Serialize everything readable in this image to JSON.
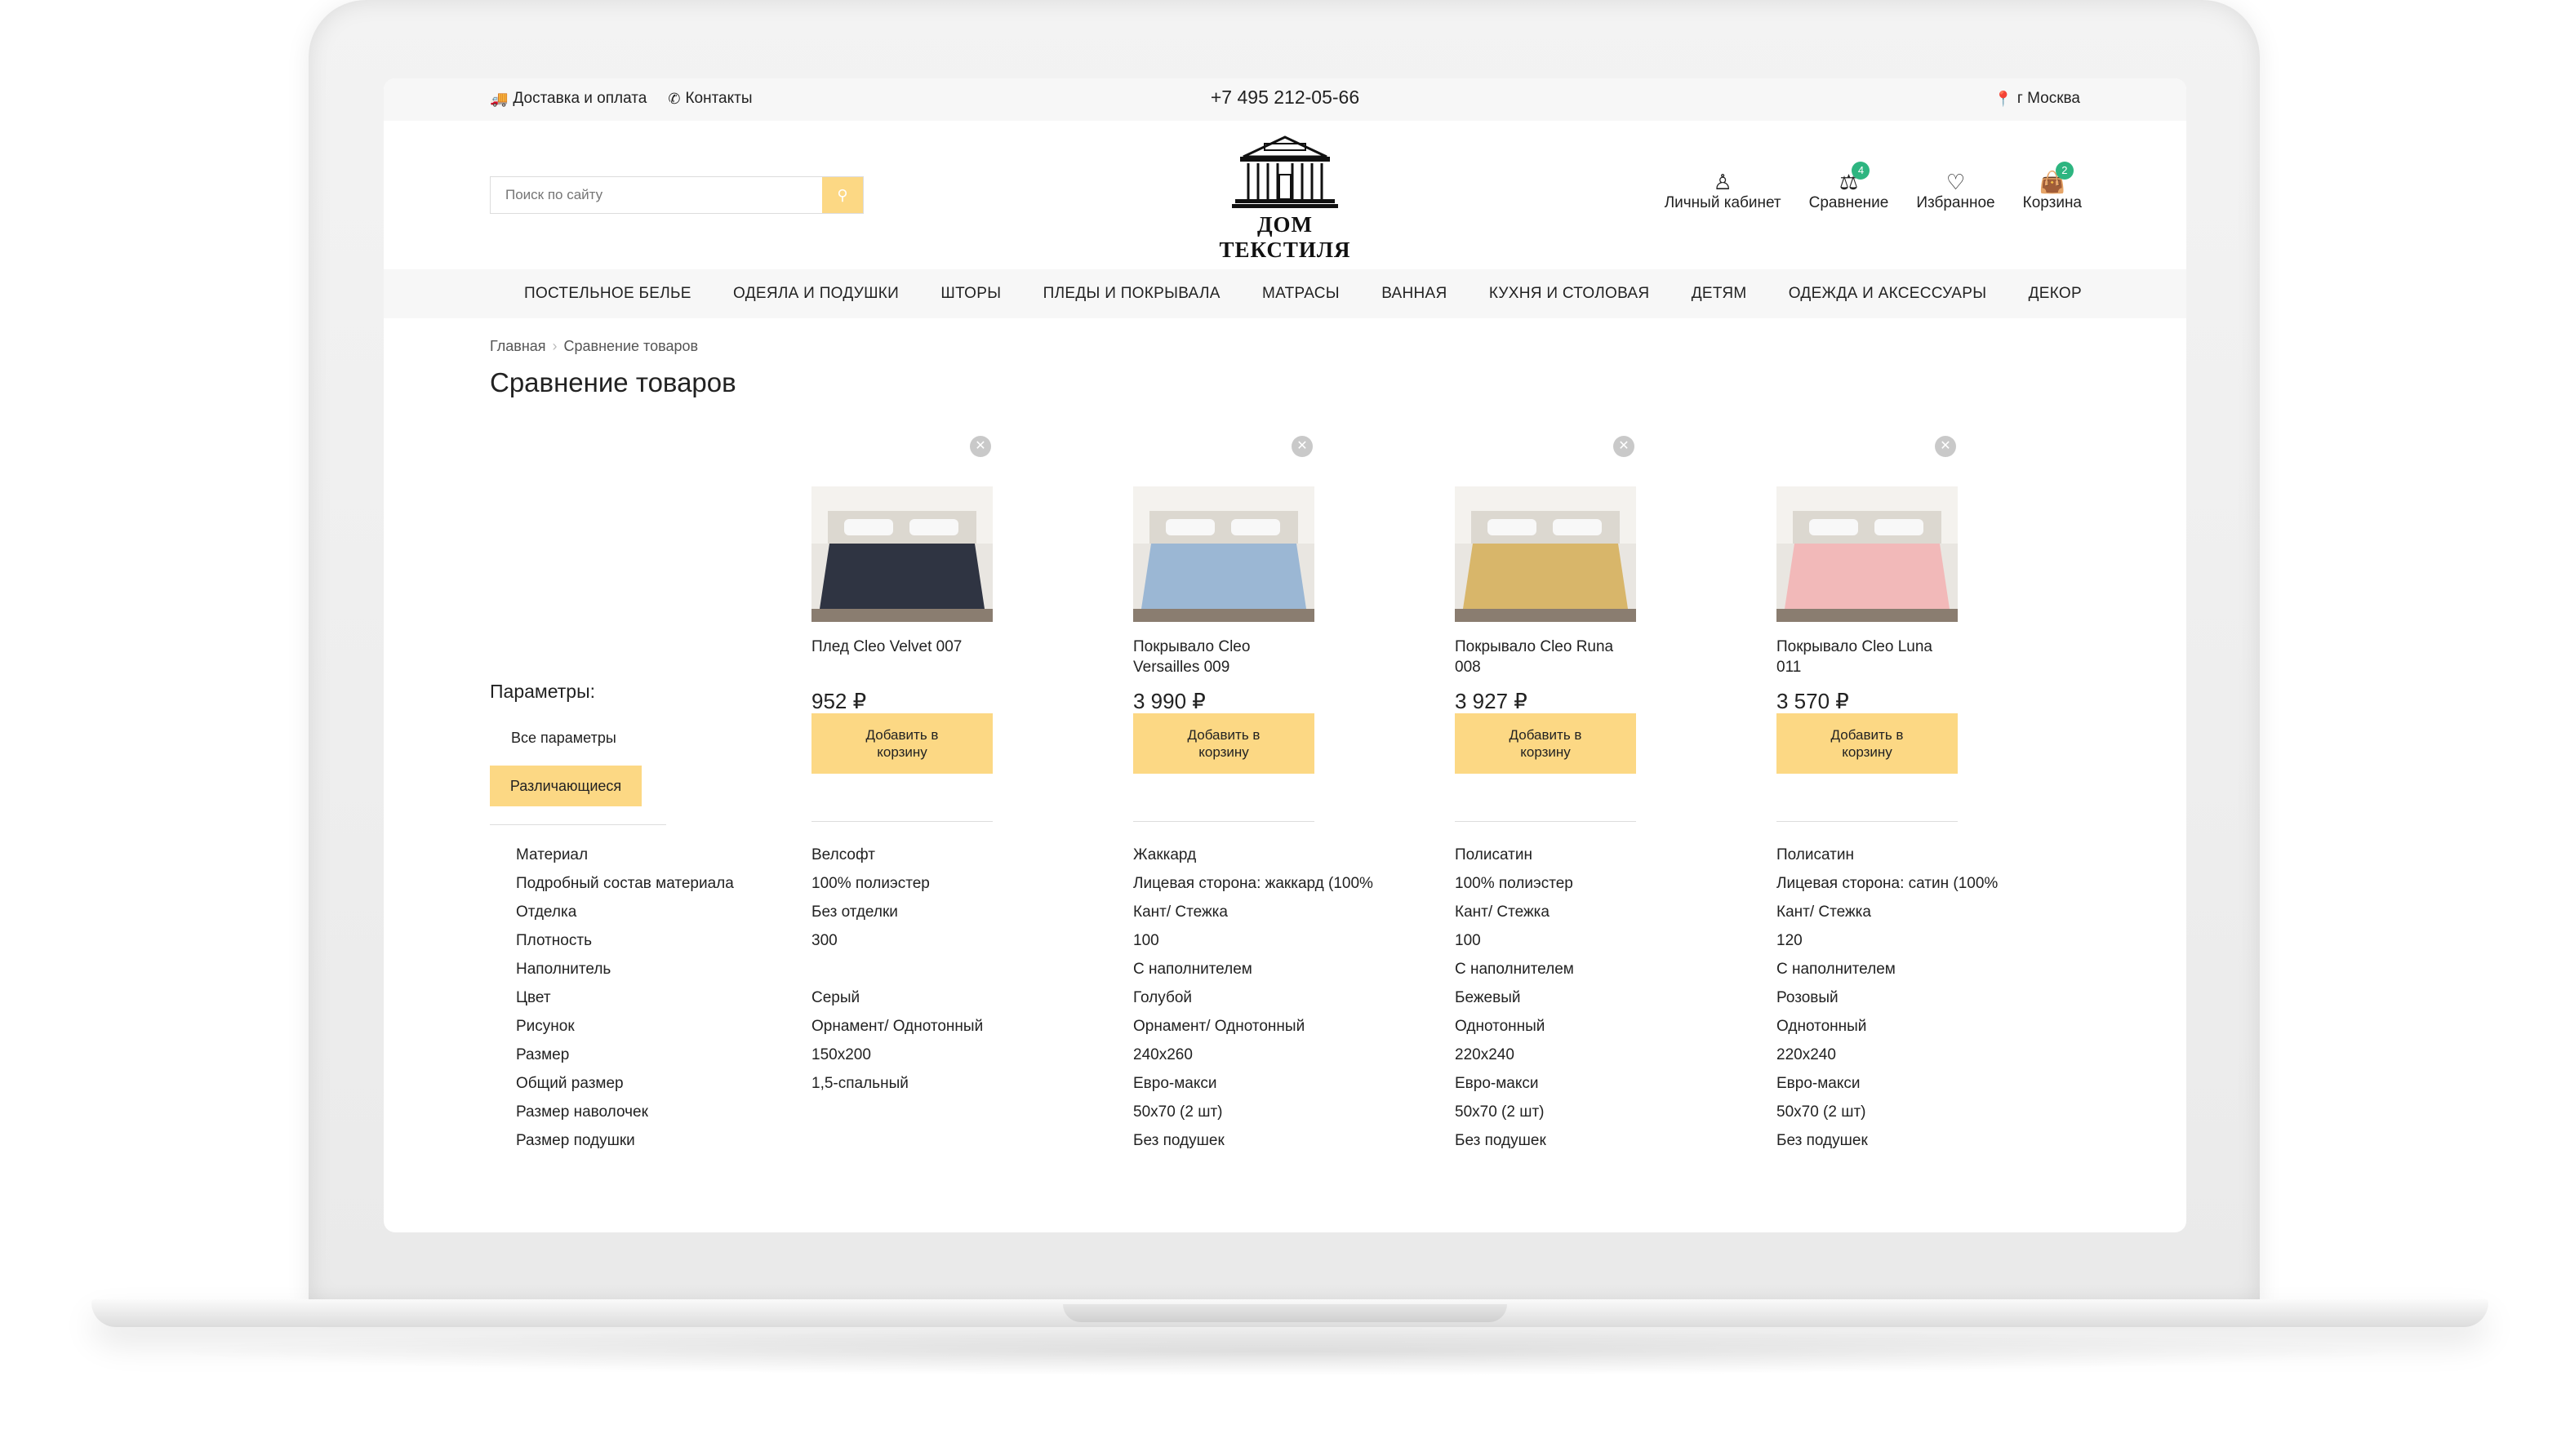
{
  "topbar": {
    "delivery": "Доставка и оплата",
    "contacts": "Контакты",
    "phone": "+7 495 212-05-66",
    "city": "г Москва"
  },
  "header": {
    "search_placeholder": "Поиск по сайту",
    "brand": "ДОМ ТЕКСТИЛЯ",
    "account": "Личный кабинет",
    "compare": "Сравнение",
    "compare_count": "4",
    "favorites": "Избранное",
    "cart": "Корзина",
    "cart_count": "2"
  },
  "nav": [
    "ПОСТЕЛЬНОЕ БЕЛЬЕ",
    "ОДЕЯЛА И ПОДУШКИ",
    "ШТОРЫ",
    "ПЛЕДЫ И ПОКРЫВАЛА",
    "МАТРАСЫ",
    "ВАННАЯ",
    "КУХНЯ И СТОЛОВАЯ",
    "ДЕТЯМ",
    "ОДЕЖДА И АКСЕССУАРЫ",
    "ДЕКОР"
  ],
  "breadcrumbs": [
    "Главная",
    "Сравнение товаров"
  ],
  "page_title": "Сравнение товаров",
  "params": {
    "title": "Параметры:",
    "tab_all": "Все параметры",
    "tab_diff": "Различающиеся"
  },
  "add_to_cart": "Добавить в корзину",
  "row_labels": [
    "Материал",
    "Подробный состав материала",
    "Отделка",
    "Плотность",
    "Наполнитель",
    "Цвет",
    "Рисунок",
    "Размер",
    "Общий размер",
    "Размер наволочек",
    "Размер подушки"
  ],
  "products": [
    {
      "name": "Плед Cleo Velvet 007",
      "price": "952 ₽",
      "color": "#2f3442",
      "values": [
        "Велсофт",
        "100% полиэстер",
        "Без отделки",
        "300",
        "",
        "Серый",
        "Орнамент/ Однотонный",
        "150х200",
        "1,5-спальный",
        "",
        ""
      ]
    },
    {
      "name": "Покрывало Cleo Versailles 009",
      "price": "3 990 ₽",
      "color": "#9bb7d4",
      "values": [
        "Жаккард",
        "Лицевая сторона: жаккард (100%",
        "Кант/ Стежка",
        "100",
        "С наполнителем",
        "Голубой",
        "Орнамент/ Однотонный",
        "240х260",
        "Евро-макси",
        "50х70 (2 шт)",
        "Без подушек"
      ]
    },
    {
      "name": "Покрывало Cleo Runa 008",
      "price": "3 927 ₽",
      "color": "#d8b66a",
      "values": [
        "Полисатин",
        "100% полиэстер",
        "Кант/ Стежка",
        "100",
        "С наполнителем",
        "Бежевый",
        "Однотонный",
        "220х240",
        "Евро-макси",
        "50х70 (2 шт)",
        "Без подушек"
      ]
    },
    {
      "name": "Покрывало Cleo Luna 011",
      "price": "3 570 ₽",
      "color": "#f2b9b9",
      "values": [
        "Полисатин",
        "Лицевая сторона: сатин (100%",
        "Кант/ Стежка",
        "120",
        "С наполнителем",
        "Розовый",
        "Однотонный",
        "220х240",
        "Евро-макси",
        "50х70 (2 шт)",
        "Без подушек"
      ]
    }
  ],
  "colors": {
    "accent": "#fcd884",
    "badge": "#2db580",
    "bar_bg": "#f7f7f7"
  }
}
